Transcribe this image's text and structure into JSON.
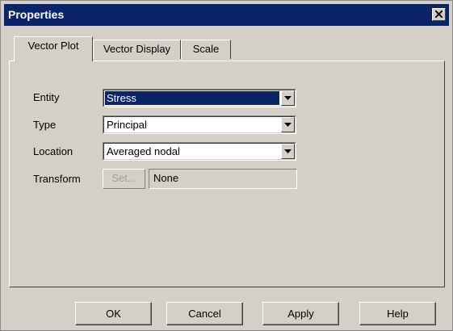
{
  "window": {
    "title": "Properties"
  },
  "tabs": [
    {
      "label": "Vector Plot",
      "active": true
    },
    {
      "label": "Vector Display",
      "active": false
    },
    {
      "label": "Scale",
      "active": false
    }
  ],
  "fields": {
    "entity": {
      "label": "Entity",
      "value": "Stress"
    },
    "type": {
      "label": "Type",
      "value": "Principal"
    },
    "location": {
      "label": "Location",
      "value": "Averaged nodal"
    },
    "transform": {
      "label": "Transform",
      "button_label": "Set...",
      "value": "None"
    }
  },
  "buttons": {
    "ok": "OK",
    "cancel": "Cancel",
    "apply": "Apply",
    "help": "Help"
  },
  "icons": {
    "close": "close-icon",
    "dropdown": "chevron-down-icon"
  },
  "colors": {
    "titlebar": "#0a246a",
    "selection": "#0a246a",
    "face": "#d4d0c8"
  }
}
